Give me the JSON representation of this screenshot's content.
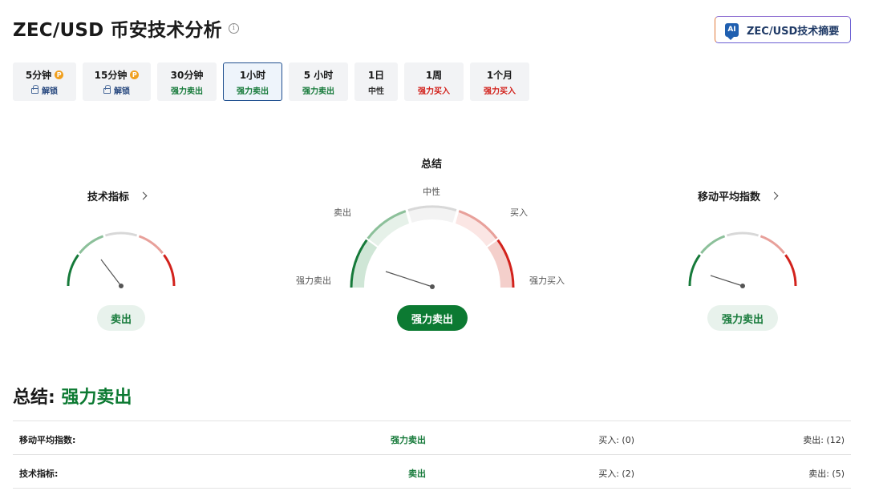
{
  "header": {
    "title": "ZEC/USD 币安技术分析",
    "ai_button_badge": "AI",
    "ai_button_label": "ZEC/USD技术摘要"
  },
  "tabs": [
    {
      "label": "5分钟",
      "sub": "解锁",
      "locked": true,
      "active": false
    },
    {
      "label": "15分钟",
      "sub": "解锁",
      "locked": true,
      "active": false
    },
    {
      "label": "30分钟",
      "sub": "强力卖出",
      "locked": false,
      "active": false
    },
    {
      "label": "1小时",
      "sub": "强力卖出",
      "locked": false,
      "active": true
    },
    {
      "label": "5 小时",
      "sub": "强力卖出",
      "locked": false,
      "active": false
    },
    {
      "label": "1日",
      "sub": "中性",
      "locked": false,
      "active": false
    },
    {
      "label": "1周",
      "sub": "强力买入",
      "locked": false,
      "active": false
    },
    {
      "label": "1个月",
      "sub": "强力买入",
      "locked": false,
      "active": false
    }
  ],
  "gauges": {
    "technical": {
      "title": "技术指标",
      "result": "卖出"
    },
    "summary": {
      "title": "总结",
      "result": "强力卖出",
      "labels": {
        "strong_sell": "强力卖出",
        "sell": "卖出",
        "neutral": "中性",
        "buy": "买入",
        "strong_buy": "强力买入"
      }
    },
    "moving_averages": {
      "title": "移动平均指数",
      "result": "强力卖出"
    }
  },
  "summary": {
    "label": "总结:",
    "value": "强力卖出"
  },
  "table": [
    {
      "name": "移动平均指数:",
      "signal": "强力卖出",
      "buy": "买入: (0)",
      "sell": "卖出: (12)"
    },
    {
      "name": "技术指标:",
      "signal": "卖出",
      "buy": "买入: (2)",
      "sell": "卖出: (5)"
    }
  ],
  "colors": {
    "strong_sell": "#167a3a",
    "sell": "#8cc09a",
    "neutral": "#d8d8d8",
    "buy": "#e8a09a",
    "strong_buy": "#d2221c"
  }
}
